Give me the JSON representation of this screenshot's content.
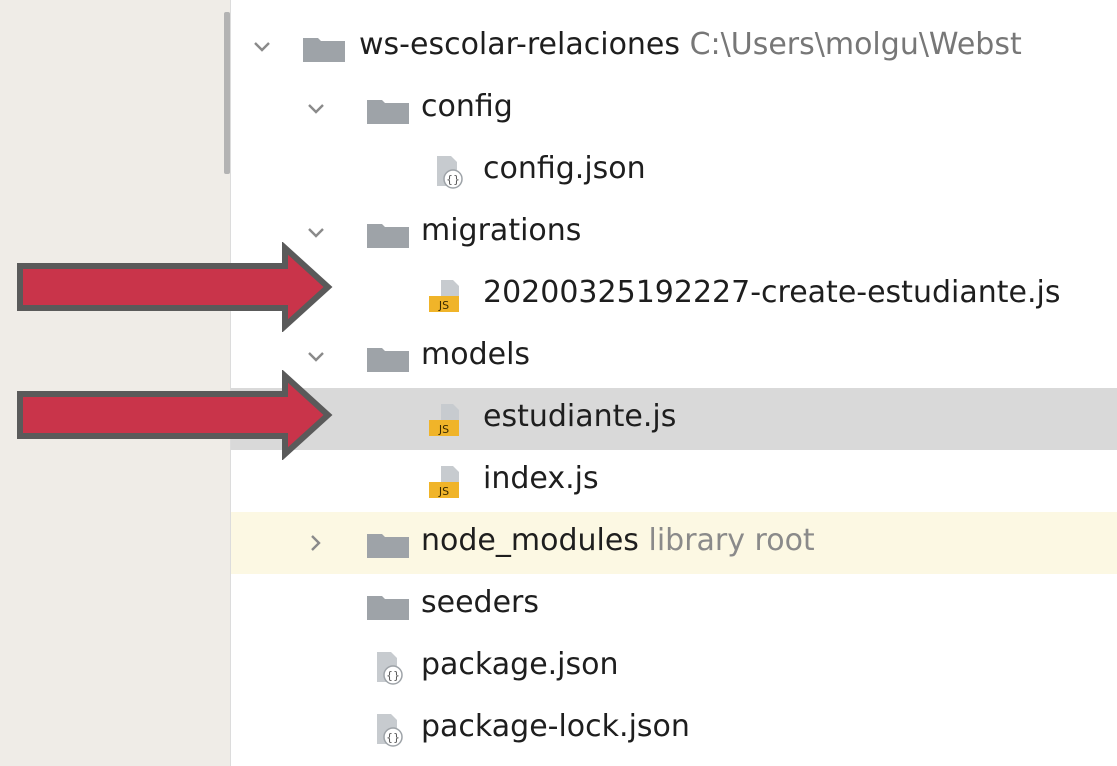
{
  "project": {
    "name": "ws-escolar-relaciones",
    "path": "C:\\Users\\molgu\\Webst"
  },
  "tree": {
    "config": "config",
    "config_json": "config.json",
    "migrations": "migrations",
    "migration_file": "20200325192227-create-estudiante.js",
    "models": "models",
    "estudiante": "estudiante.js",
    "index": "index.js",
    "node_modules": "node_modules",
    "node_modules_hint": "library root",
    "seeders": "seeders",
    "package_json": "package.json",
    "package_lock": "package-lock.json"
  },
  "icons": {
    "js_badge": "JS",
    "json_badge": "{}"
  },
  "colors": {
    "arrow": "#c9344a",
    "arrow_outline": "#5a5a5a",
    "selected_row": "#d9d9d9",
    "library_row": "#fcf8e3",
    "js_icon": "#f0b429",
    "folder_icon": "#9ea3a8"
  }
}
